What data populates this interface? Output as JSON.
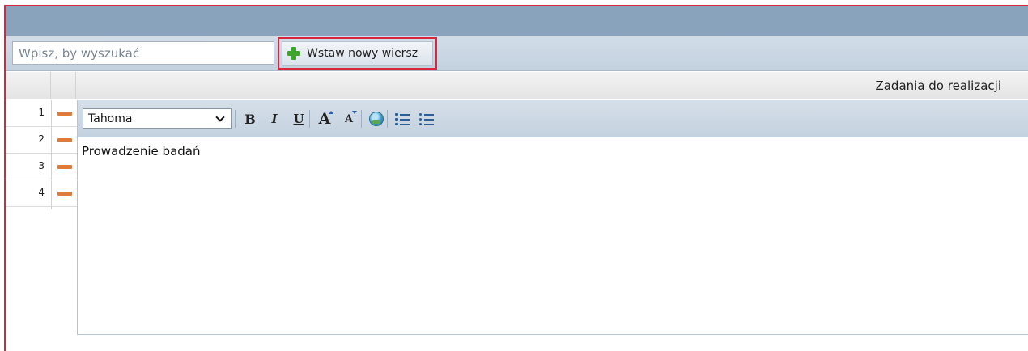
{
  "toolbar": {
    "search_placeholder": "Wpisz, by wyszukać",
    "add_row_label": "Wstaw nowy wiersz",
    "add_row_icon": "plus-icon"
  },
  "grid": {
    "column_header": "Zadania do realizacji",
    "rows": [
      {
        "number": "1",
        "action_icon": "minus-icon"
      },
      {
        "number": "2",
        "action_icon": "minus-icon"
      },
      {
        "number": "3",
        "action_icon": "minus-icon"
      },
      {
        "number": "4",
        "action_icon": "minus-icon"
      }
    ]
  },
  "editor": {
    "font_family_value": "Tahoma",
    "toolbar_icons": [
      "bold-icon",
      "italic-icon",
      "underline-icon",
      "font-grow-icon",
      "font-shrink-icon",
      "globe-icon",
      "ordered-list-icon",
      "unordered-list-icon"
    ],
    "content_text": "Prowadzenie badań"
  },
  "colors": {
    "highlight_border": "#d8263a",
    "title_bar": "#8aa3bc",
    "add_icon": "#3fa52f",
    "row_delete_icon": "#e07a3a"
  }
}
